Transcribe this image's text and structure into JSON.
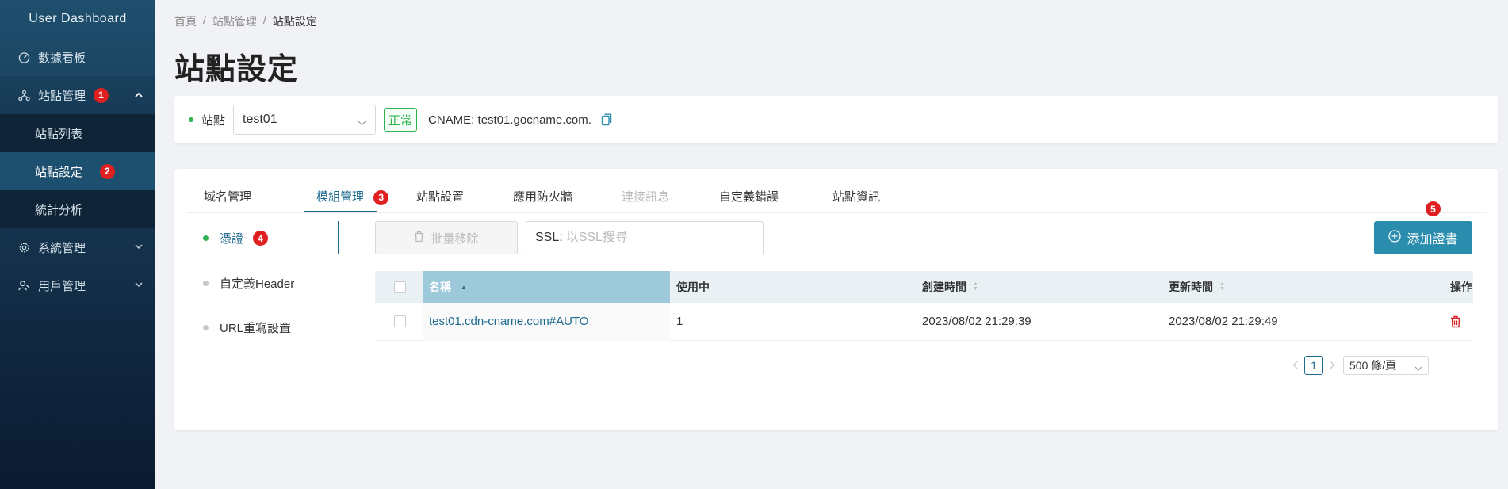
{
  "sidebar": {
    "brand": "User Dashboard",
    "items": [
      {
        "label": "數據看板",
        "icon": "dashboard-icon"
      },
      {
        "label": "站點管理",
        "icon": "sitemap-icon",
        "badge": "1",
        "children": [
          {
            "label": "站點列表"
          },
          {
            "label": "站點設定",
            "badge": "2",
            "active": true
          },
          {
            "label": "統計分析"
          }
        ]
      },
      {
        "label": "系統管理",
        "icon": "gear-icon"
      },
      {
        "label": "用戶管理",
        "icon": "user-icon"
      }
    ]
  },
  "breadcrumb": [
    "首頁",
    "/",
    "站點管理",
    "/",
    "站點設定"
  ],
  "page_title": "站點設定",
  "site_bar": {
    "label": "站點",
    "selected_site": "test01",
    "status": "正常",
    "cname": "CNAME: test01.gocname.com."
  },
  "tabs": [
    {
      "label": "域名管理"
    },
    {
      "label": "模組管理",
      "active": true,
      "badge": "3"
    },
    {
      "label": "站點設置"
    },
    {
      "label": "應用防火牆"
    },
    {
      "label": "連接訊息",
      "disabled": true
    },
    {
      "label": "自定義錯誤"
    },
    {
      "label": "站點資訊"
    }
  ],
  "modules": [
    {
      "label": "憑證",
      "active": true,
      "badge": "4"
    },
    {
      "label": "自定義Header"
    },
    {
      "label": "URL重寫設置"
    }
  ],
  "toolbar": {
    "batch_remove": "批量移除",
    "ssl_prefix": "SSL:",
    "ssl_placeholder": "以SSL搜尋",
    "add_cert": "添加證書",
    "add_badge": "5"
  },
  "table": {
    "headers": {
      "name": "名稱",
      "in_use": "使用中",
      "created": "創建時間",
      "updated": "更新時間",
      "actions": "操作"
    },
    "rows": [
      {
        "name": "test01.cdn-cname.com#AUTO",
        "in_use": "1",
        "created": "2023/08/02 21:29:39",
        "updated": "2023/08/02 21:29:49"
      }
    ]
  },
  "pagination": {
    "current": "1",
    "page_size": "500 條/頁"
  },
  "colors": {
    "accent": "#1d6a8f",
    "primary_button": "#2a8dae",
    "success": "#2fb350",
    "badge": "#e02020",
    "delete": "#e02020"
  }
}
